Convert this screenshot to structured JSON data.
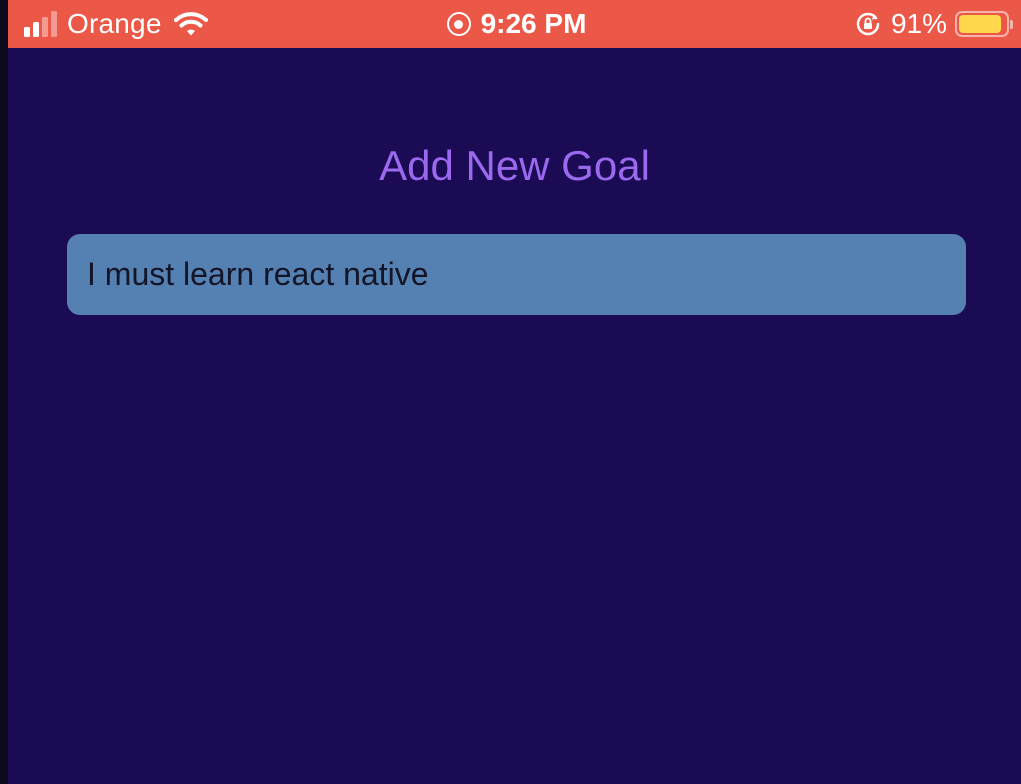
{
  "status_bar": {
    "carrier": "Orange",
    "time": "9:26 PM",
    "battery_percent_label": "91%",
    "battery_level": 0.91,
    "signal_bars_active": 2,
    "signal_bars_total": 4,
    "icons": [
      "signal-bars-icon",
      "wifi-icon",
      "screen-recording-icon",
      "orientation-lock-icon",
      "battery-icon"
    ],
    "bar_color": "#ec5848",
    "battery_fill_color": "#ffd84d"
  },
  "screen": {
    "title": "Add New Goal",
    "goal_input": {
      "value": "I must learn react native"
    }
  },
  "colors": {
    "background": "#1b0a54",
    "title": "#9a69ee",
    "input_background": "#5581b2",
    "input_text": "#141427"
  }
}
